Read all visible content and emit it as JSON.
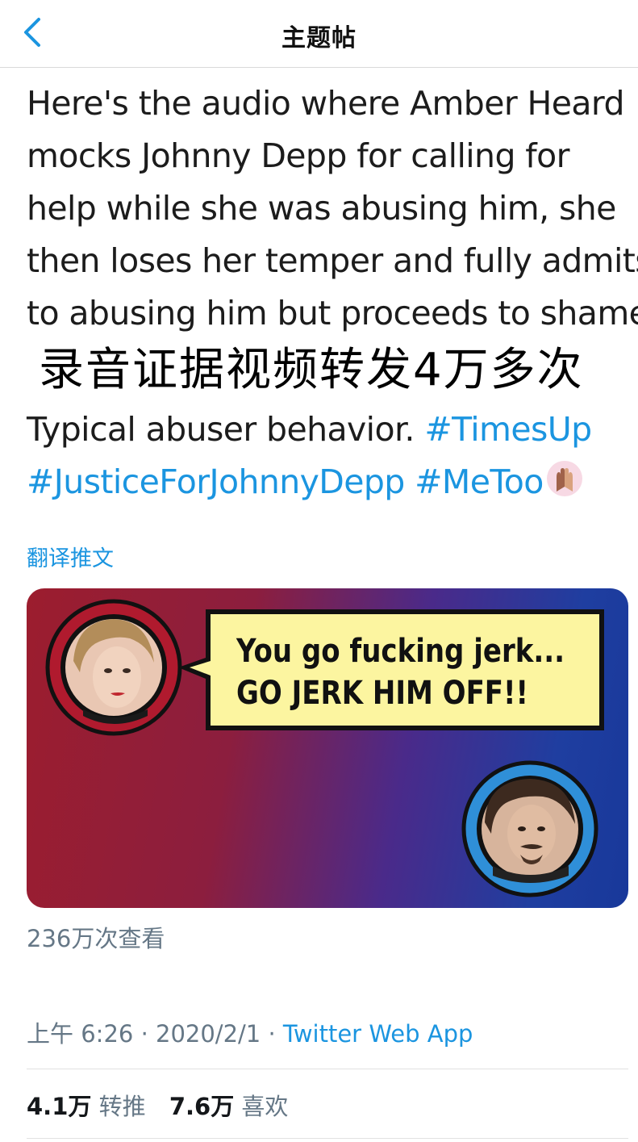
{
  "header": {
    "title": "主题帖"
  },
  "tweet": {
    "lines": [
      "Here's the audio where Amber Heard",
      "mocks Johnny Depp for calling for",
      "help while she was abusing him, she",
      "then loses her temper and fully admits",
      "to abusing him but proceeds to shame"
    ],
    "overlay_caption": "录音证据视频转发4万多次",
    "tail_text": "Typical abuser behavior.",
    "hashtags": [
      "#TimesUp",
      "#JusticeForJohnnyDepp",
      "#MeToo"
    ],
    "translate_label": "翻译推文"
  },
  "media": {
    "speech_line1": "You go fucking jerk...",
    "speech_line2": "GO JERK HIM OFF!!",
    "colors": {
      "bubble_fill": "#fcf5a0",
      "ring_red": "#b01a2e",
      "ring_blue": "#2f8fd8"
    }
  },
  "views": "236万次查看",
  "meta": {
    "time": "上午 6:26",
    "date": "2020/2/1",
    "separator": "·",
    "source": "Twitter Web App"
  },
  "stats": {
    "retweets_num": "4.1万",
    "retweets_label": "转推",
    "likes_num": "7.6万",
    "likes_label": "喜欢"
  },
  "colors": {
    "link_blue": "#1b95e0",
    "meta_gray": "#657786"
  }
}
